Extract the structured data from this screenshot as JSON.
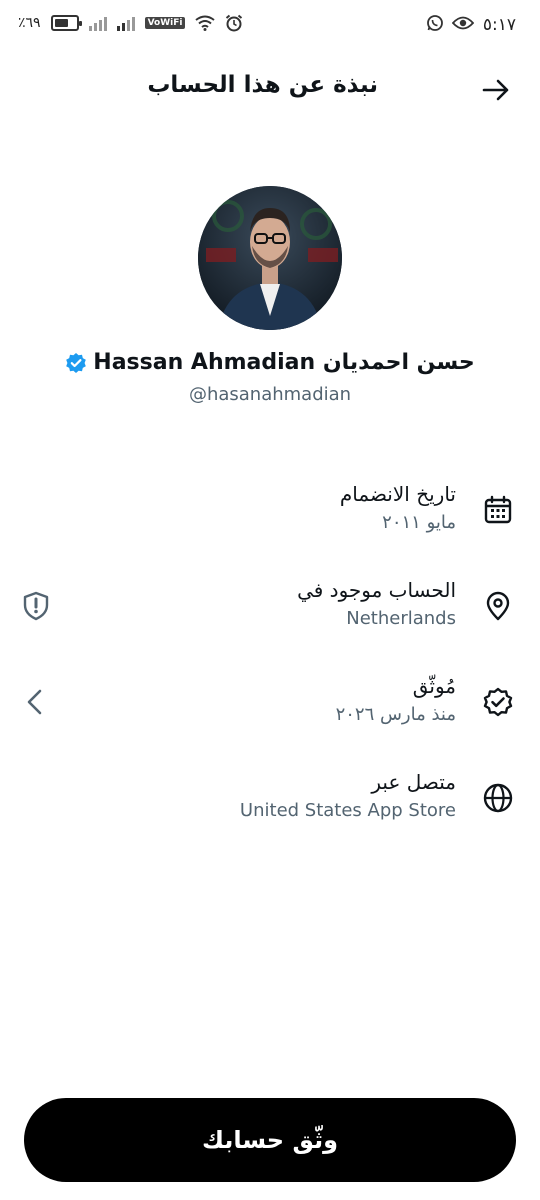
{
  "status_bar": {
    "time": "٥:١٧",
    "battery_percent": "٪٦٩",
    "battery_level": 0.69,
    "wifi_call_label": "VoWiFi"
  },
  "header": {
    "title": "نبذة عن هذا الحساب"
  },
  "profile": {
    "display_name": "حسن احمديان Hassan Ahmadian",
    "handle": "@hasanahmadian",
    "verified_color": "#1d9bf0"
  },
  "info": {
    "joined": {
      "label": "تاريخ الانضمام",
      "value": "مايو ٢٠١١"
    },
    "location": {
      "label": "الحساب موجود في",
      "value": "Netherlands"
    },
    "verified": {
      "label": "مُوثّق",
      "value": "منذ مارس ٢٠٢٦"
    },
    "connected": {
      "label": "متصل عبر",
      "value": "United States App Store"
    }
  },
  "cta": {
    "label": "وثّق حسابك"
  }
}
